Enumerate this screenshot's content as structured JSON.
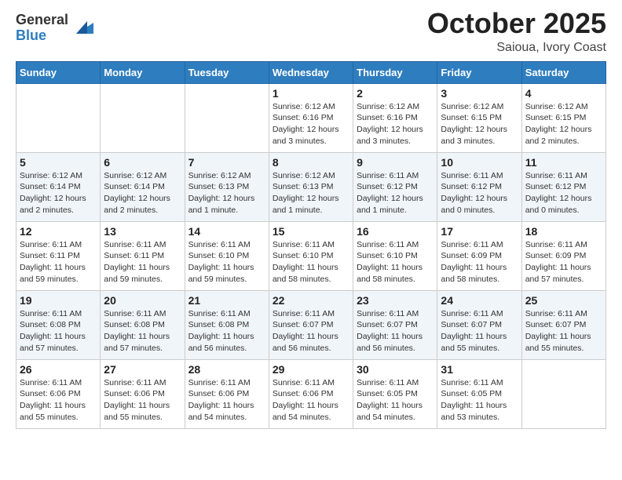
{
  "logo": {
    "general": "General",
    "blue": "Blue"
  },
  "header": {
    "month": "October 2025",
    "location": "Saioua, Ivory Coast"
  },
  "weekdays": [
    "Sunday",
    "Monday",
    "Tuesday",
    "Wednesday",
    "Thursday",
    "Friday",
    "Saturday"
  ],
  "weeks": [
    [
      {
        "day": "",
        "info": ""
      },
      {
        "day": "",
        "info": ""
      },
      {
        "day": "",
        "info": ""
      },
      {
        "day": "1",
        "info": "Sunrise: 6:12 AM\nSunset: 6:16 PM\nDaylight: 12 hours\nand 3 minutes."
      },
      {
        "day": "2",
        "info": "Sunrise: 6:12 AM\nSunset: 6:16 PM\nDaylight: 12 hours\nand 3 minutes."
      },
      {
        "day": "3",
        "info": "Sunrise: 6:12 AM\nSunset: 6:15 PM\nDaylight: 12 hours\nand 3 minutes."
      },
      {
        "day": "4",
        "info": "Sunrise: 6:12 AM\nSunset: 6:15 PM\nDaylight: 12 hours\nand 2 minutes."
      }
    ],
    [
      {
        "day": "5",
        "info": "Sunrise: 6:12 AM\nSunset: 6:14 PM\nDaylight: 12 hours\nand 2 minutes."
      },
      {
        "day": "6",
        "info": "Sunrise: 6:12 AM\nSunset: 6:14 PM\nDaylight: 12 hours\nand 2 minutes."
      },
      {
        "day": "7",
        "info": "Sunrise: 6:12 AM\nSunset: 6:13 PM\nDaylight: 12 hours\nand 1 minute."
      },
      {
        "day": "8",
        "info": "Sunrise: 6:12 AM\nSunset: 6:13 PM\nDaylight: 12 hours\nand 1 minute."
      },
      {
        "day": "9",
        "info": "Sunrise: 6:11 AM\nSunset: 6:12 PM\nDaylight: 12 hours\nand 1 minute."
      },
      {
        "day": "10",
        "info": "Sunrise: 6:11 AM\nSunset: 6:12 PM\nDaylight: 12 hours\nand 0 minutes."
      },
      {
        "day": "11",
        "info": "Sunrise: 6:11 AM\nSunset: 6:12 PM\nDaylight: 12 hours\nand 0 minutes."
      }
    ],
    [
      {
        "day": "12",
        "info": "Sunrise: 6:11 AM\nSunset: 6:11 PM\nDaylight: 11 hours\nand 59 minutes."
      },
      {
        "day": "13",
        "info": "Sunrise: 6:11 AM\nSunset: 6:11 PM\nDaylight: 11 hours\nand 59 minutes."
      },
      {
        "day": "14",
        "info": "Sunrise: 6:11 AM\nSunset: 6:10 PM\nDaylight: 11 hours\nand 59 minutes."
      },
      {
        "day": "15",
        "info": "Sunrise: 6:11 AM\nSunset: 6:10 PM\nDaylight: 11 hours\nand 58 minutes."
      },
      {
        "day": "16",
        "info": "Sunrise: 6:11 AM\nSunset: 6:10 PM\nDaylight: 11 hours\nand 58 minutes."
      },
      {
        "day": "17",
        "info": "Sunrise: 6:11 AM\nSunset: 6:09 PM\nDaylight: 11 hours\nand 58 minutes."
      },
      {
        "day": "18",
        "info": "Sunrise: 6:11 AM\nSunset: 6:09 PM\nDaylight: 11 hours\nand 57 minutes."
      }
    ],
    [
      {
        "day": "19",
        "info": "Sunrise: 6:11 AM\nSunset: 6:08 PM\nDaylight: 11 hours\nand 57 minutes."
      },
      {
        "day": "20",
        "info": "Sunrise: 6:11 AM\nSunset: 6:08 PM\nDaylight: 11 hours\nand 57 minutes."
      },
      {
        "day": "21",
        "info": "Sunrise: 6:11 AM\nSunset: 6:08 PM\nDaylight: 11 hours\nand 56 minutes."
      },
      {
        "day": "22",
        "info": "Sunrise: 6:11 AM\nSunset: 6:07 PM\nDaylight: 11 hours\nand 56 minutes."
      },
      {
        "day": "23",
        "info": "Sunrise: 6:11 AM\nSunset: 6:07 PM\nDaylight: 11 hours\nand 56 minutes."
      },
      {
        "day": "24",
        "info": "Sunrise: 6:11 AM\nSunset: 6:07 PM\nDaylight: 11 hours\nand 55 minutes."
      },
      {
        "day": "25",
        "info": "Sunrise: 6:11 AM\nSunset: 6:07 PM\nDaylight: 11 hours\nand 55 minutes."
      }
    ],
    [
      {
        "day": "26",
        "info": "Sunrise: 6:11 AM\nSunset: 6:06 PM\nDaylight: 11 hours\nand 55 minutes."
      },
      {
        "day": "27",
        "info": "Sunrise: 6:11 AM\nSunset: 6:06 PM\nDaylight: 11 hours\nand 55 minutes."
      },
      {
        "day": "28",
        "info": "Sunrise: 6:11 AM\nSunset: 6:06 PM\nDaylight: 11 hours\nand 54 minutes."
      },
      {
        "day": "29",
        "info": "Sunrise: 6:11 AM\nSunset: 6:06 PM\nDaylight: 11 hours\nand 54 minutes."
      },
      {
        "day": "30",
        "info": "Sunrise: 6:11 AM\nSunset: 6:05 PM\nDaylight: 11 hours\nand 54 minutes."
      },
      {
        "day": "31",
        "info": "Sunrise: 6:11 AM\nSunset: 6:05 PM\nDaylight: 11 hours\nand 53 minutes."
      },
      {
        "day": "",
        "info": ""
      }
    ]
  ]
}
